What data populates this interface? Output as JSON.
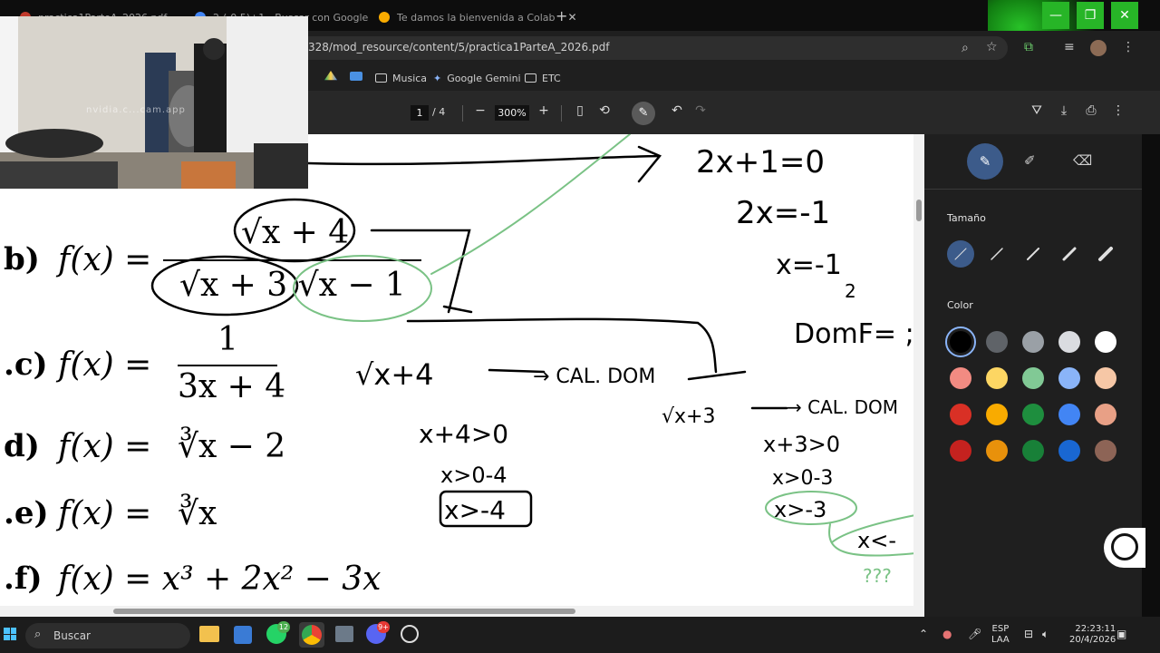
{
  "browser": {
    "tabs": [
      {
        "label": "practica1ParteA_2026.pdf",
        "active": false
      },
      {
        "label": "2-(-0.5)+1 - Buscar con Google",
        "active": true
      },
      {
        "label": "Te damos la bienvenida a Colab",
        "active": false
      }
    ],
    "new_tab": "+",
    "window_controls": {
      "minimize": "—",
      "restore": "❐",
      "close": "✕"
    },
    "url": "328/mod_resource/content/5/practica1ParteA_2026.pdf",
    "bookmarks": [
      "Musica",
      "Google Gemini",
      "ETC"
    ]
  },
  "pdf_toolbar": {
    "page_current": "1",
    "page_separator": "/",
    "page_total": "4",
    "zoom": "300%",
    "zoom_out": "−",
    "zoom_in": "+"
  },
  "document": {
    "problems": [
      {
        "label": "b)",
        "function": "f(x) =",
        "numerator": "√x + 4",
        "denominator": "√x + 3 √x − 1"
      },
      {
        "label": ".c)",
        "function": "f(x) =",
        "numerator": "1",
        "denominator": "3x + 4"
      },
      {
        "label": "d)",
        "function": "f(x) =",
        "expr": "∛x − 2"
      },
      {
        "label": ".e)",
        "function": "f(x) =",
        "expr": "∛x"
      },
      {
        "label": ".f)",
        "function": "f(x) = x³ + 2x² − 3x",
        "expr": ""
      }
    ],
    "handwriting": {
      "top_right": [
        "2x+1=0",
        "2x=-1",
        "x=-1",
        "2",
        "DomF= ;"
      ],
      "middle": [
        "√x+4",
        "→ CAL. DOM",
        "x+4>0",
        "x>0-4",
        "x>-4"
      ],
      "right": [
        "√x+3",
        "→ CAL. DOM",
        "x+3>0",
        "x>0-3",
        "x>-3",
        "x<-",
        "???"
      ]
    }
  },
  "annotation_panel": {
    "tools": [
      "pen-icon",
      "highlighter-icon",
      "eraser-icon"
    ],
    "size_title": "Tamaño",
    "color_title": "Color",
    "colors": [
      [
        "#000000",
        "#5f6368",
        "#9aa0a6",
        "#dadce0",
        "#ffffff"
      ],
      [
        "#f28b82",
        "#fdd663",
        "#81c995",
        "#8ab4f8",
        "#f6c7a6"
      ],
      [
        "#d93025",
        "#f9ab00",
        "#1e8e3e",
        "#4285f4",
        "#e8a086"
      ],
      [
        "#c5221f",
        "#e8910b",
        "#188038",
        "#1967d2",
        "#8d6456"
      ]
    ]
  },
  "webcam": {
    "watermark": "nvidia.c...cam.app"
  },
  "taskbar": {
    "search_placeholder": "Buscar",
    "badges": {
      "whatsapp": "12",
      "discord": "9+"
    },
    "language": "ESP",
    "layout": "LAA",
    "time": "22:23:11",
    "date": "20/4/2026"
  }
}
